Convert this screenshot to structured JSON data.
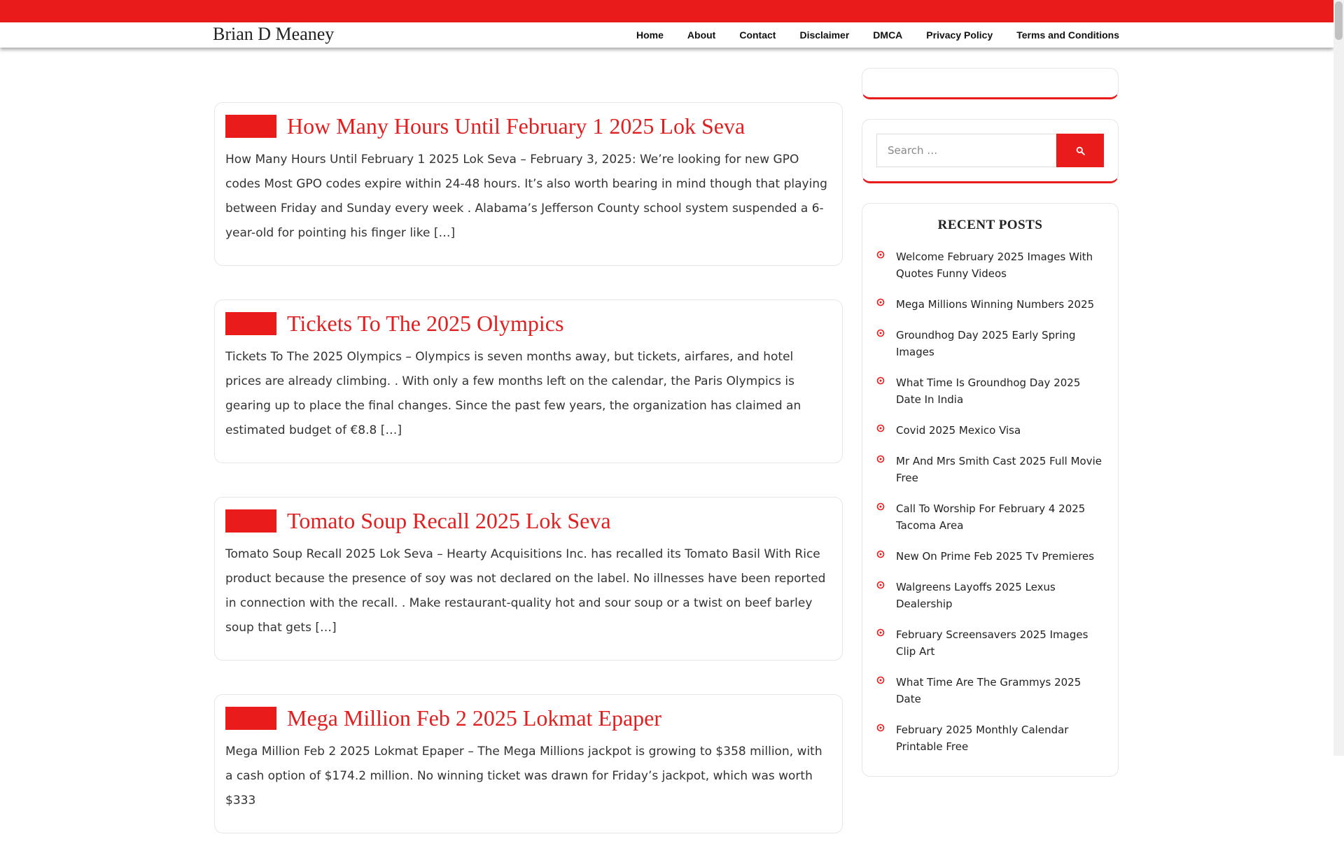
{
  "site": {
    "title": "Brian D Meaney"
  },
  "nav": {
    "items": [
      "Home",
      "About",
      "Contact",
      "Disclaimer",
      "DMCA",
      "Privacy Policy",
      "Terms and Conditions"
    ]
  },
  "posts": [
    {
      "title": "How Many Hours Until February 1 2025 Lok Seva",
      "excerpt": "How Many Hours Until February 1 2025 Lok Seva – February 3, 2025: We’re looking for new GPO codes Most GPO codes expire within 24-48 hours. It’s also worth bearing in mind though that playing between Friday and Sunday every week . Alabama’s Jefferson County school system suspended a 6-year-old for pointing his finger like […]"
    },
    {
      "title": "Tickets To The 2025 Olympics",
      "excerpt": "Tickets To The 2025 Olympics – Olympics is seven months away, but tickets, airfares, and hotel prices are already climbing. . With only a few months left on the calendar, the Paris Olympics is gearing up to place the final changes. Since the past few years, the organization has claimed an estimated budget of €8.8 […]"
    },
    {
      "title": "Tomato Soup Recall 2025 Lok Seva",
      "excerpt": "Tomato Soup Recall 2025 Lok Seva – Hearty Acquisitions Inc. has recalled its Tomato Basil With Rice product because the presence of soy was not declared on the label. No illnesses have been reported in connection with the recall. . Make restaurant-quality hot and sour soup or a twist on beef barley soup that gets […]"
    },
    {
      "title": "Mega Million Feb 2 2025 Lokmat Epaper",
      "excerpt": "Mega Million Feb 2 2025 Lokmat Epaper – The Mega Millions jackpot is growing to $358 million, with a cash option of $174.2 million. No winning ticket was drawn for Friday’s jackpot, which was worth $333"
    }
  ],
  "search": {
    "placeholder": "Search …"
  },
  "recent": {
    "title": "RECENT POSTS",
    "items": [
      "Welcome February 2025 Images With Quotes Funny Videos",
      "Mega Millions Winning Numbers 2025",
      "Groundhog Day 2025 Early Spring Images",
      "What Time Is Groundhog Day 2025 Date In India",
      "Covid 2025 Mexico Visa",
      "Mr And Mrs Smith Cast 2025 Full Movie Free",
      "Call To Worship For February 4 2025 Tacoma Area",
      "New On Prime Feb 2025 Tv Premieres",
      "Walgreens Layoffs 2025 Lexus Dealership",
      "February Screensavers 2025 Images Clip Art",
      "What Time Are The Grammys 2025 Date",
      "February 2025 Monthly Calendar Printable Free"
    ]
  },
  "colors": {
    "accent": "#e91b1b",
    "title_red": "#e02020"
  },
  "icons": {
    "search": "search-icon",
    "bullet": "circle-dot-icon"
  }
}
